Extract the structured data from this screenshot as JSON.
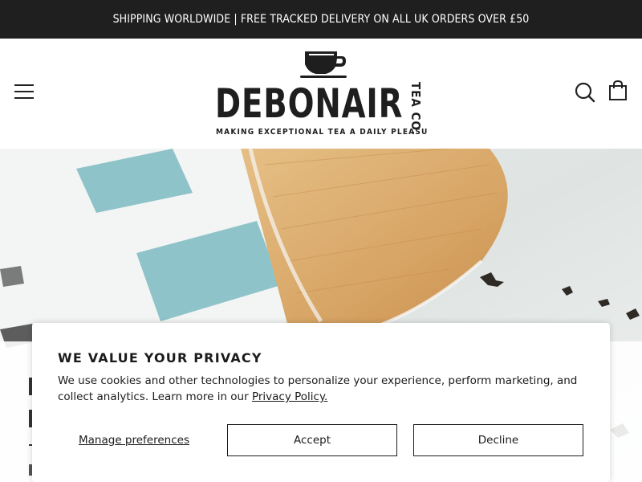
{
  "announcement": {
    "text": "SHIPPING WORLDWIDE | FREE TRACKED DELIVERY ON ALL UK ORDERS OVER £50"
  },
  "header": {
    "logo": {
      "name": "DEBONAIR",
      "subbrand": "TEA CO.",
      "tagline": "MAKING EXCEPTIONAL TEA A DAILY PLEASURE"
    },
    "icons": {
      "menu": "hamburger-menu-icon",
      "search": "search-icon",
      "cart": "shopping-bag-icon"
    }
  },
  "cookie_banner": {
    "title": "WE VALUE YOUR PRIVACY",
    "text": "We use cookies and other technologies to personalize your experience, perform marketing, and collect analytics. Learn more in our ",
    "link_text": "Privacy Policy.",
    "manage_label": "Manage preferences",
    "accept_label": "Accept",
    "decline_label": "Decline"
  },
  "colors": {
    "announcement_bg": "#1f1f1f",
    "text": "#1b1b1b",
    "hero_teal": "#8ec3c9",
    "hero_wood": "#d9a96b"
  }
}
